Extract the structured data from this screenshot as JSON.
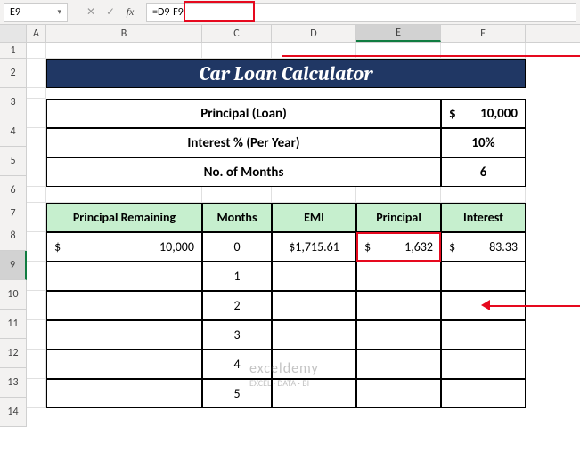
{
  "formula_bar": {
    "cell_ref": "E9",
    "formula": "=D9-F9"
  },
  "columns": [
    "A",
    "B",
    "C",
    "D",
    "E",
    "F"
  ],
  "rows": [
    "1",
    "2",
    "3",
    "4",
    "5",
    "6",
    "7",
    "8",
    "9",
    "10",
    "11",
    "12",
    "13",
    "14"
  ],
  "title": "Car Loan Calculator",
  "params": {
    "principal_label": "Principal (Loan)",
    "principal_currency": "$",
    "principal_value": "10,000",
    "interest_label": "Interest % (Per Year)",
    "interest_value": "10%",
    "months_label": "No. of Months",
    "months_value": "6"
  },
  "headers": {
    "principal_remaining": "Principal Remaining",
    "months": "Months",
    "emi": "EMI",
    "principal": "Principal",
    "interest": "Interest"
  },
  "data_row": {
    "principal_remaining_currency": "$",
    "principal_remaining_value": "10,000",
    "months": "0",
    "emi": "$1,715.61",
    "principal_currency": "$",
    "principal_value": "1,632",
    "interest_currency": "$",
    "interest_value": "83.33"
  },
  "months_col": [
    "1",
    "2",
    "3",
    "4",
    "5"
  ],
  "watermark": {
    "title": "exceldemy",
    "tag": "EXCEL · DATA · BI"
  },
  "icons": {
    "cancel": "✕",
    "enter": "✓",
    "fx": "fx",
    "dropdown": "▾"
  }
}
